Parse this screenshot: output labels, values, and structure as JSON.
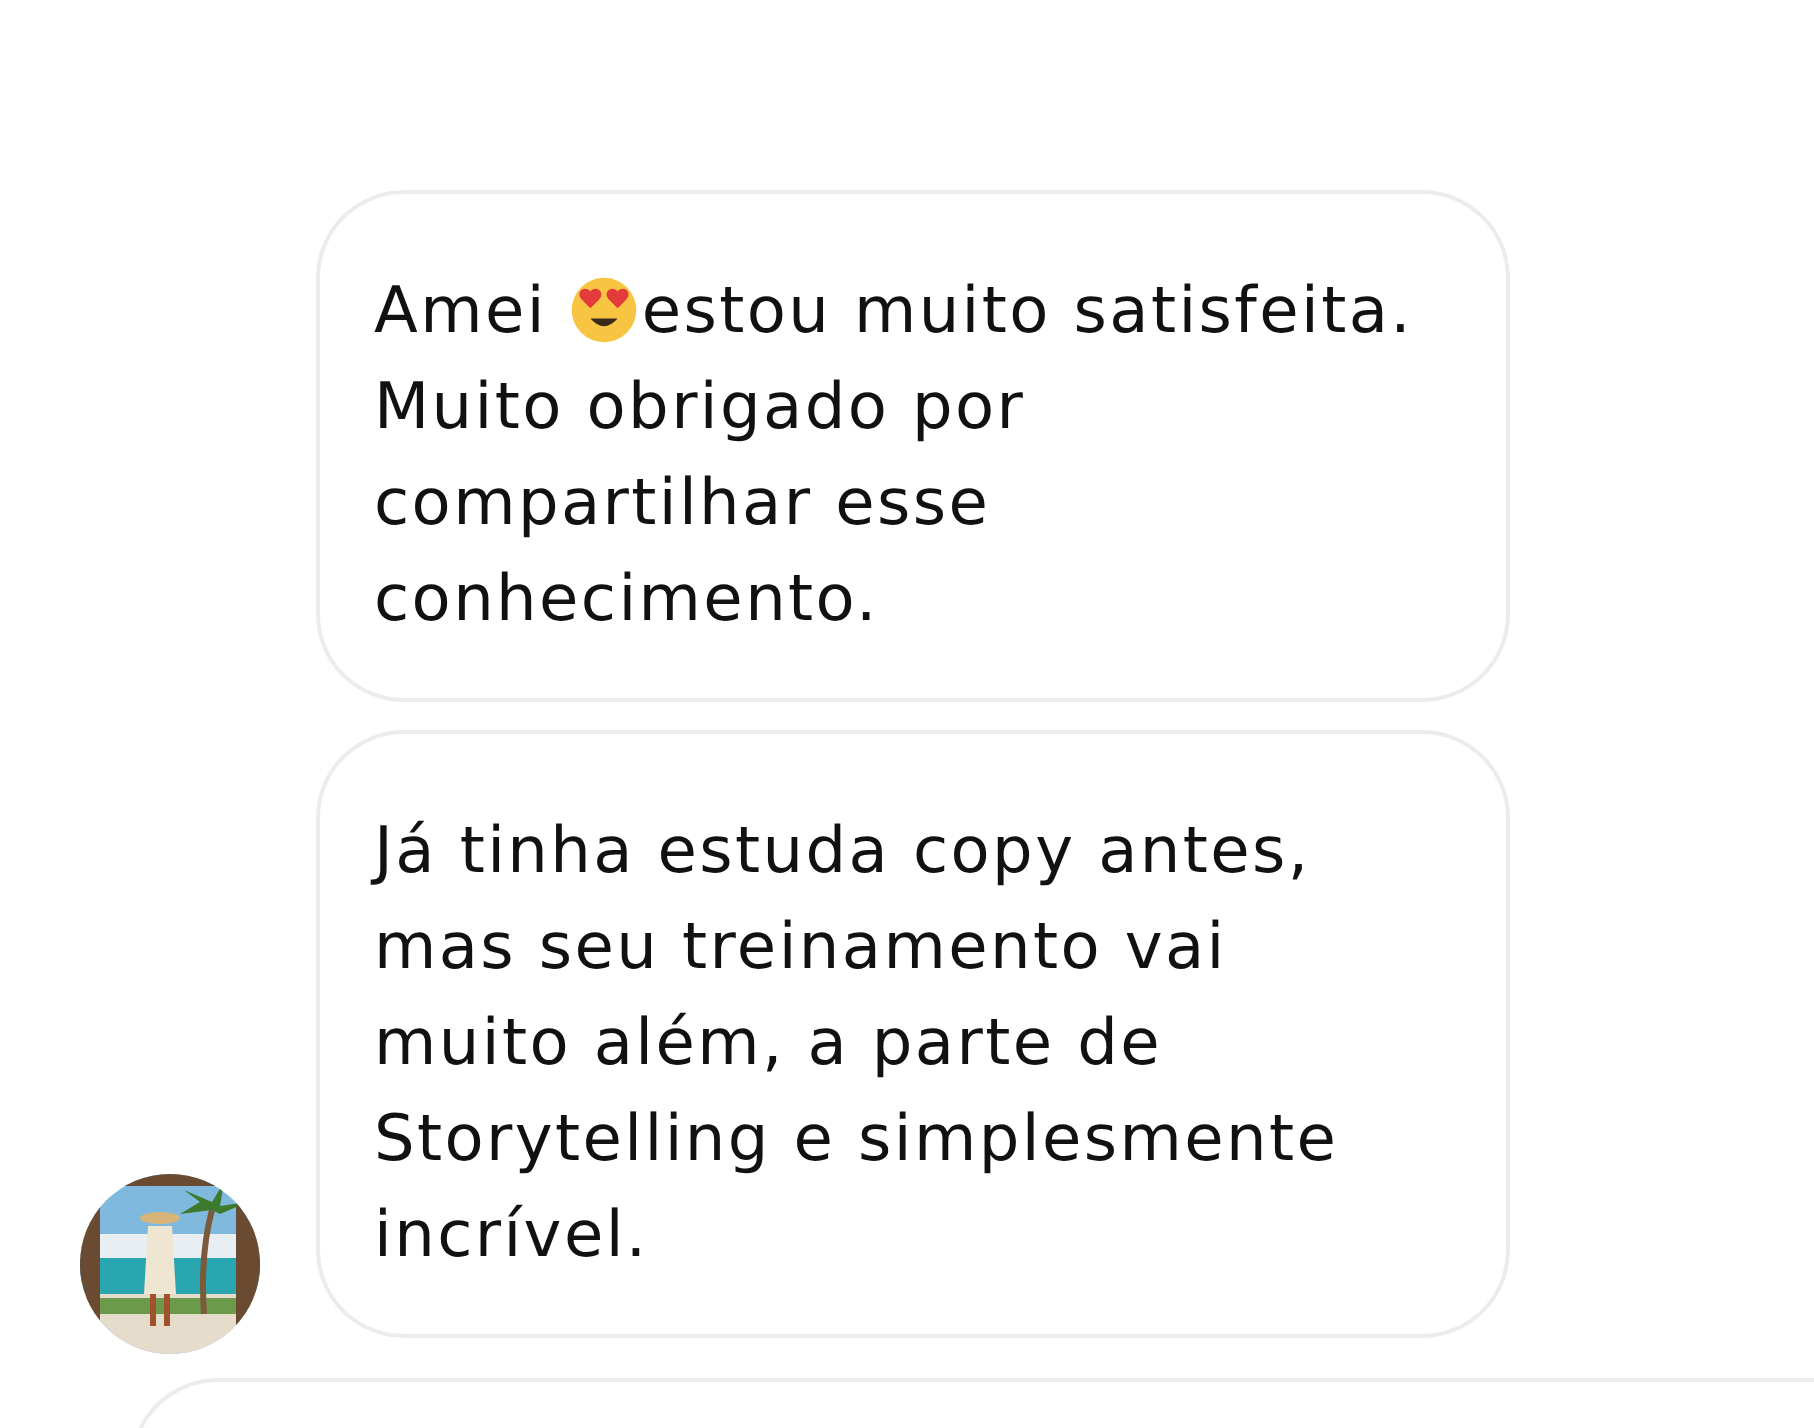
{
  "messages": [
    {
      "avatar": false,
      "parts": [
        {
          "kind": "text",
          "text": "Amei "
        },
        {
          "kind": "emoji"
        },
        {
          "kind": "text",
          "text": "estou muito satisfeita. Muito obrigado por compartilhar esse conhecimento."
        }
      ]
    },
    {
      "avatar": true,
      "parts": [
        {
          "kind": "text",
          "text": "Já tinha estuda copy antes, mas seu treinamento vai muito além, a parte de Storytelling e simplesmente incrível."
        }
      ]
    }
  ]
}
